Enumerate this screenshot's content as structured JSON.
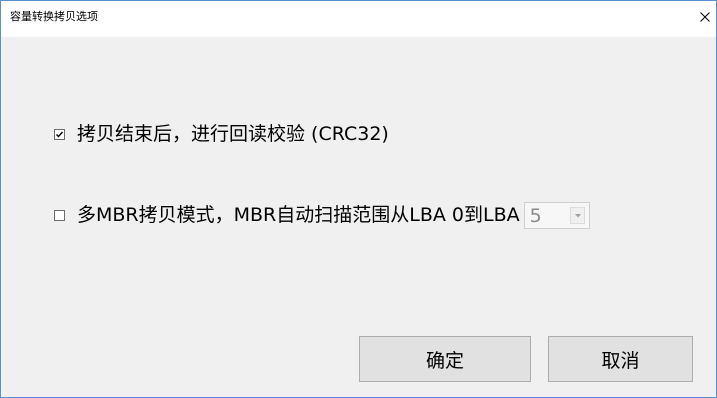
{
  "window": {
    "title": "容量转换拷贝选项",
    "close_glyph": "×"
  },
  "options": {
    "crc_verify": {
      "label": "拷贝结束后，进行回读校验 (CRC32)",
      "checked": true
    },
    "multi_mbr": {
      "label": "多MBR拷贝模式，MBR自动扫描范围从LBA 0到LBA",
      "checked": false,
      "lba_select": {
        "value": "5",
        "disabled": true
      }
    }
  },
  "buttons": {
    "ok_label": "确定",
    "cancel_label": "取消"
  },
  "icons": {
    "close": "close-icon",
    "checkmark": "checkmark-icon",
    "dropdown": "chevron-down-icon"
  },
  "colors": {
    "window_border": "#5b8fd0",
    "dialog_background": "#f0f0f0",
    "titlebar_background": "#ffffff",
    "button_face": "#e1e1e1",
    "button_border": "#adadad",
    "disabled_text": "#8a8a8a"
  }
}
